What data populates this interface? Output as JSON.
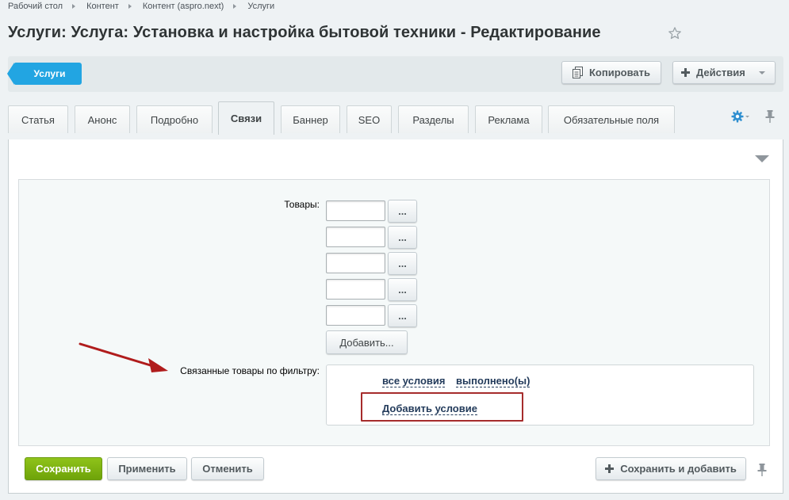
{
  "breadcrumb": [
    "Рабочий стол",
    "Контент",
    "Контент (aspro.next)",
    "Услуги"
  ],
  "page_title": "Услуги: Услуга: Установка и настройка бытовой техники - Редактирование",
  "toolbar": {
    "back_label": "Услуги",
    "copy_label": "Копировать",
    "actions_label": "Действия"
  },
  "tabs": [
    {
      "label": "Статья"
    },
    {
      "label": "Анонс"
    },
    {
      "label": "Подробно"
    },
    {
      "label": "Связи",
      "active": true
    },
    {
      "label": "Баннер"
    },
    {
      "label": "SEO"
    },
    {
      "label": "Разделы"
    },
    {
      "label": "Реклама"
    },
    {
      "label": "Обязательные поля"
    }
  ],
  "form": {
    "products_label": "Товары:",
    "products_inputs": [
      "",
      "",
      "",
      "",
      ""
    ],
    "browse_label": "...",
    "add_label": "Добавить...",
    "filter_label": "Связанные товары по фильтру:",
    "filter_all_conditions": "все условия",
    "filter_fulfilled": "выполнено(ы)",
    "filter_add_condition": "Добавить условие"
  },
  "footer": {
    "save_label": "Сохранить",
    "apply_label": "Применить",
    "cancel_label": "Отменить",
    "save_add_label": "Сохранить и добавить"
  },
  "colors": {
    "accent_blue": "#22a5e2",
    "save_green": "#7bb30f",
    "highlight_red": "#a62c2c",
    "link_navy": "#233b5b"
  },
  "icons": {
    "favorite": "star-icon",
    "copy": "copy-icon",
    "actions": "plus-icon",
    "settings": "gear-icon",
    "pin": "pin-icon",
    "collapse": "collapse-triangle-icon"
  }
}
